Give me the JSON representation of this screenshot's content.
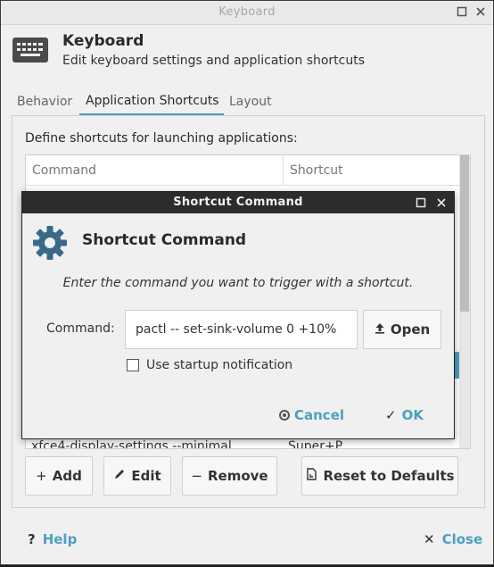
{
  "window": {
    "title": "Keyboard"
  },
  "header": {
    "icon": "keyboard-icon",
    "title": "Keyboard",
    "subtitle": "Edit keyboard settings and application shortcuts"
  },
  "tabs": [
    {
      "label": "Behavior",
      "active": false
    },
    {
      "label": "Application Shortcuts",
      "active": true
    },
    {
      "label": "Layout",
      "active": false
    }
  ],
  "shortcuts_panel": {
    "label": "Define shortcuts for launching applications:",
    "columns": [
      "Command",
      "Shortcut"
    ],
    "visible_row": {
      "command": "xfce4-display-settings --minimal",
      "shortcut": "Super+P"
    }
  },
  "buttons": {
    "add": "Add",
    "edit": "Edit",
    "remove": "Remove",
    "reset": "Reset to Defaults"
  },
  "footer": {
    "help": "Help",
    "close": "Close"
  },
  "dialog": {
    "title": "Shortcut Command",
    "heading": "Shortcut Command",
    "icon": "gear-icon",
    "description": "Enter the command you want to trigger with a shortcut.",
    "command_label": "Command:",
    "command_value": "pactl -- set-sink-volume 0 +10%",
    "open_label": "Open",
    "startup_notification_label": "Use startup notification",
    "startup_notification_checked": false,
    "cancel_label": "Cancel",
    "ok_label": "OK"
  },
  "colors": {
    "accent": "#4f9fbf",
    "dialog_titlebar": "#2c2c2c"
  }
}
